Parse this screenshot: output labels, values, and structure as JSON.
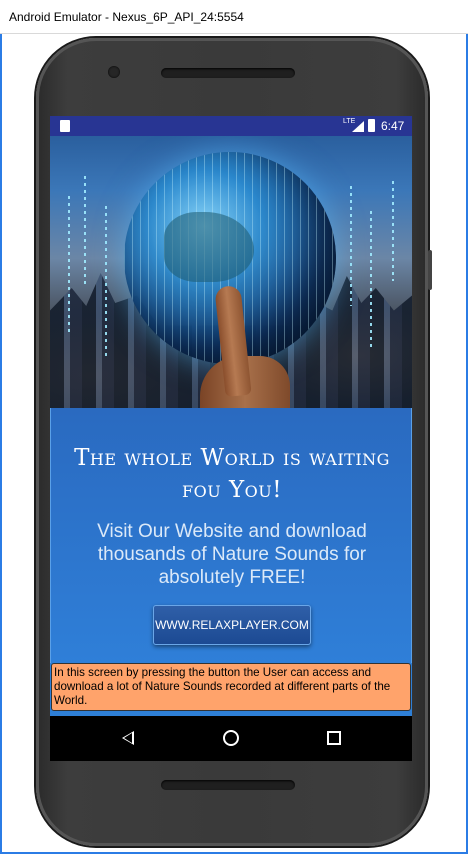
{
  "window": {
    "title": "Android Emulator - Nexus_6P_API_24:5554"
  },
  "status_bar": {
    "network": "LTE",
    "time": "6:47"
  },
  "hero": {
    "image_icons": [
      "globe-icon",
      "finger-icon"
    ]
  },
  "content": {
    "headline": "The whole World is waiting fou You!",
    "subtext": "Visit Our Website and download thousands of Nature Sounds for absolutely FREE!",
    "button_label": "WWW.RELAXPLAYER.COM"
  },
  "note": {
    "text": "In this screen by pressing the button the User can access and download a lot of Nature Sounds recorded at different parts of the World."
  },
  "nav_bar": {
    "icons": [
      "back-icon",
      "home-icon",
      "recent-apps-icon"
    ]
  },
  "colors": {
    "status_bar": "#283593",
    "content_bg": "#2e7fd6",
    "button_bg": "#1c4a93",
    "note_bg": "#ffa36b"
  }
}
